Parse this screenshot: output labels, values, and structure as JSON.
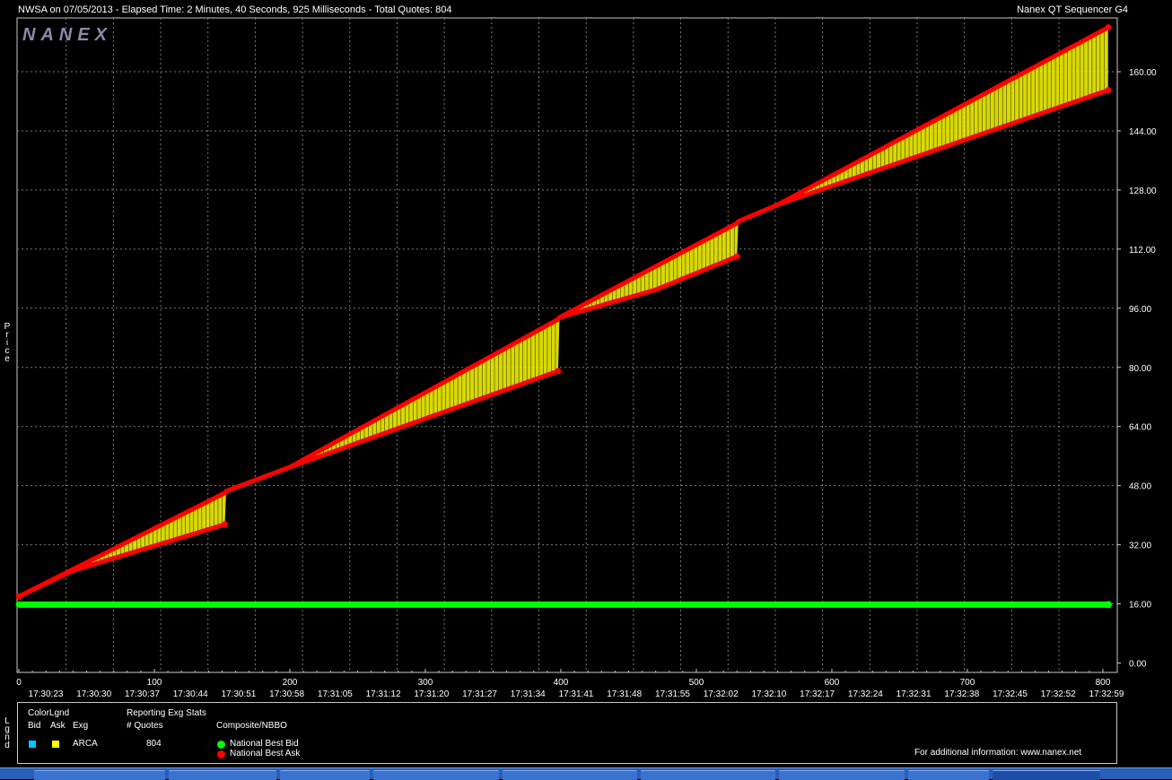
{
  "header": {
    "title_left": "NWSA on 07/05/2013  -  Elapsed Time: 2 Minutes, 40 Seconds, 925 Milliseconds  -  Total Quotes: 804",
    "title_right": "Nanex QT Sequencer G4"
  },
  "watermark": "NANEX",
  "side_labels": {
    "price": "Price",
    "legend": "Lgnd"
  },
  "colors": {
    "background": "#000000",
    "grid": "#7a7a7a",
    "bid": "#00ff00",
    "ask": "#ff0000",
    "band": "#ffff00",
    "exchange_bid": "#00c8ff",
    "exchange_ask": "#ffff00"
  },
  "chart_data": {
    "type": "line",
    "y_ticks": [
      "0.00",
      "16.00",
      "32.00",
      "48.00",
      "64.00",
      "80.00",
      "96.00",
      "112.00",
      "128.00",
      "144.00",
      "160.00"
    ],
    "ylim": [
      -2,
      172
    ],
    "x_ticks": [
      "0",
      "100",
      "200",
      "300",
      "400",
      "500",
      "600",
      "700",
      "800"
    ],
    "xlim": [
      0,
      806
    ],
    "time_labels": [
      "17:30:23",
      "17:30:30",
      "17:30:37",
      "17:30:44",
      "17:30:51",
      "17:30:58",
      "17:31:05",
      "17:31:12",
      "17:31:20",
      "17:31:27",
      "17:31:34",
      "17:31:41",
      "17:31:48",
      "17:31:55",
      "17:32:02",
      "17:32:10",
      "17:32:17",
      "17:32:24",
      "17:32:31",
      "17:32:38",
      "17:32:45",
      "17:32:52",
      "17:32:59"
    ],
    "grid": true,
    "series": [
      {
        "name": "National Best Bid",
        "x": [
          0,
          804
        ],
        "y": [
          15.8,
          15.8
        ]
      },
      {
        "name": "National Best Ask",
        "x": [
          0,
          152,
          153,
          200,
          398,
          399,
          530,
          531,
          560,
          804
        ],
        "y": [
          18,
          46,
          46.5,
          53,
          93,
          93.5,
          119,
          119.5,
          124,
          172
        ]
      },
      {
        "name": "Band lower edge",
        "x": [
          0,
          40,
          152,
          153,
          200,
          398,
          399,
          470,
          530,
          531,
          560,
          804
        ],
        "y": [
          18,
          25,
          37.5,
          46.5,
          53,
          79,
          93.5,
          101,
          110,
          119.5,
          124,
          155
        ]
      }
    ]
  },
  "legend": {
    "col1_title": "ColorLgnd",
    "col1_headers": [
      "Bid",
      "Ask",
      "Exg"
    ],
    "col2_title": "Reporting Exg Stats",
    "col2_header": "# Quotes",
    "col3_header": "Composite/NBBO",
    "row": {
      "exchange": "ARCA",
      "quotes": "804"
    },
    "composite": [
      {
        "label": "National Best Bid",
        "color": "#00ff00"
      },
      {
        "label": "National Best Ask",
        "color": "#ff0000"
      }
    ],
    "info": "For additional information: www.nanex.net"
  }
}
